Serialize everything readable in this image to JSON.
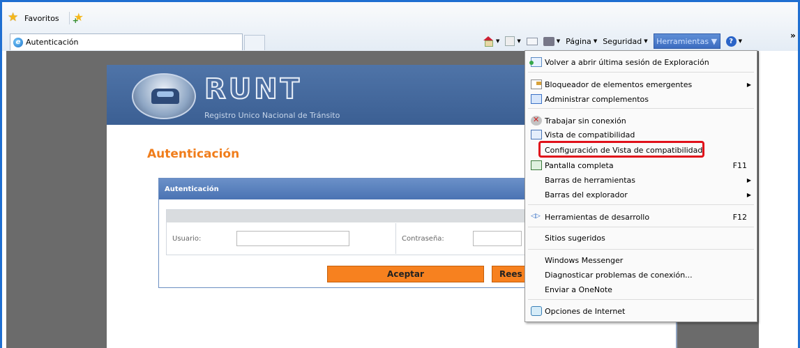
{
  "browser": {
    "favorites_label": "Favoritos",
    "tab_title": "Autenticación",
    "command_bar": {
      "page_label": "Página",
      "security_label": "Seguridad",
      "tools_label": "Herramientas",
      "overflow_glyph": "»"
    }
  },
  "page": {
    "logo_text": "RUNT",
    "logo_subtitle": "Registro Unico Nacional de Tránsito",
    "heading": "Autenticación",
    "panel_title": "Autenticación",
    "user_label": "Usuario:",
    "password_label": "Contraseña:",
    "accept_button": "Aceptar",
    "reset_button_partial": "Rees"
  },
  "tools_menu": {
    "items": [
      {
        "label": "Volver a abrir última sesión de Exploración",
        "icon": "reopen-session-icon"
      },
      {
        "label": "Bloqueador de elementos emergentes",
        "icon": "popup-blocker-icon",
        "submenu": true
      },
      {
        "label": "Administrar complementos",
        "icon": "addons-icon"
      },
      {
        "label": "Trabajar sin conexión",
        "icon": "offline-icon"
      },
      {
        "label": "Vista de compatibilidad",
        "icon": "compatibility-view-icon"
      },
      {
        "label": "Configuración de Vista de compatibilidad",
        "highlighted": true
      },
      {
        "label": "Pantalla completa",
        "icon": "fullscreen-icon",
        "shortcut": "F11"
      },
      {
        "label": "Barras de herramientas",
        "submenu": true
      },
      {
        "label": "Barras del explorador",
        "submenu": true
      },
      {
        "label": "Herramientas de desarrollo",
        "icon": "developer-tools-icon",
        "shortcut": "F12"
      },
      {
        "label": "Sitios sugeridos"
      },
      {
        "label": "Windows Messenger"
      },
      {
        "label": "Diagnosticar problemas de conexión..."
      },
      {
        "label": "Enviar a OneNote"
      },
      {
        "label": "Opciones de Internet",
        "icon": "internet-options-icon"
      }
    ]
  },
  "colors": {
    "accent_orange": "#f07d1b",
    "highlight_red": "#e0101a",
    "banner_blue": "#4a6ea3"
  }
}
